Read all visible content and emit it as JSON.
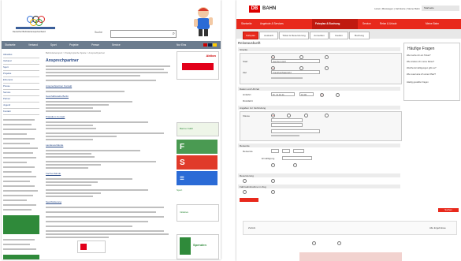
{
  "left_page": {
    "logo_text": "Deutscher Behindertensportverband",
    "search_label": "Suche",
    "nav_items": [
      "Startseite",
      "Verband",
      "Sport",
      "Projekte",
      "Presse",
      "Service"
    ],
    "nav_right": "Nur Eins",
    "sidebar_items": [
      "Aktuelles",
      "Verband",
      "Sport",
      "Projekte",
      "Ehrenamt",
      "Presse",
      "Service",
      "Partner",
      "Jugend",
      "Kontakt"
    ],
    "breadcrumb": "Behindertensport > Paralympische Spiele > Ansprechpartner",
    "heading": "Ansprechpartner",
    "links": [
      "Ansprechpartner Kontakt",
      "Geschäftsstelle Berlin",
      "Präsidium Kontakt",
      "Landesverbände",
      "Fachverbände",
      "Sportförderung"
    ],
    "ads": [
      "Aktion",
      "Barmer GEK",
      "Sport",
      "Initiative",
      "Spenden"
    ]
  },
  "right_page": {
    "brand": "BAHN",
    "util_links": "Hotel | Mietwagen | Fahrkarte | Meine Bahn",
    "util_button": "Startseite",
    "nav_items": [
      "Startseite",
      "Angebote & Services",
      "Fahrplan & Buchung",
      "Service",
      "Reise & Urlaub",
      "Meine Bahn"
    ],
    "tabs": [
      "Fahrplan",
      "Auskunft",
      "Ticket & Reservierung",
      "Anmelden",
      "Kaufen",
      "Buchung"
    ],
    "section_title": "Reiseauskunft",
    "sections": [
      "Strecke",
      "Datum und Uhrzeit",
      "Angaben zur Verbindung",
      "Reisende",
      "Reservierung",
      "Fahrradmitnahme im Zug"
    ],
    "labels": {
      "from": "Start",
      "to": "Ziel",
      "date": "Hinfahrt",
      "back": "Rückfahrt",
      "class": "Klasse",
      "persons": "Reisende",
      "bahncard": "Ermäßigung"
    },
    "inputs": {
      "from": "Hamburg Hbf",
      "to": "Frankfurt(Main)Hbf",
      "date": "Di, 11.10.11",
      "time": "10:00"
    },
    "aside_title": "Häufige Fragen",
    "aside_items": [
      "Wie buche ich ein Ticket?",
      "Wie ändere ich meine Reise?",
      "Welche Ermäßigungen gibt es?",
      "Wie reserviere ich einen Platz?",
      "Häufig gestellte Fragen"
    ],
    "search_button": "Suchen",
    "footer_links": [
      "Zurück",
      "Alle Ergebnisse"
    ]
  },
  "colors": {
    "db_red": "#e8291c",
    "dbs_blue": "#2b4b87",
    "dbs_green": "#2f8a3a",
    "nav_grey": "#6c7c8e"
  }
}
